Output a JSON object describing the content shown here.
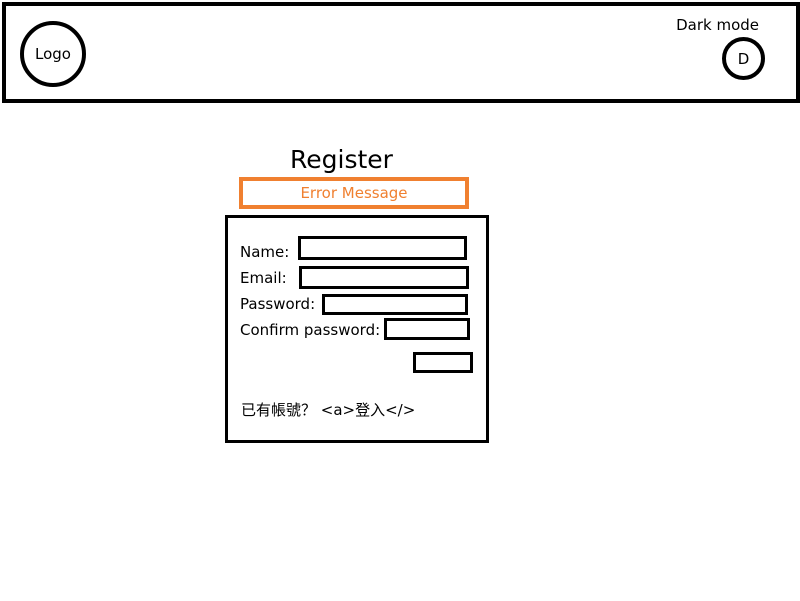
{
  "header": {
    "logo_label": "Logo",
    "dark_mode_label": "Dark mode",
    "dark_mode_toggle_label": "D"
  },
  "register": {
    "title": "Register",
    "error_message": "Error Message",
    "fields": {
      "name_label": "Name:",
      "email_label": "Email:",
      "password_label": "Password:",
      "confirm_password_label": "Confirm password:"
    },
    "footer": {
      "prompt": "已有帳號？ ",
      "link_text": "<a>登入</>"
    }
  },
  "colors": {
    "error": "#f08030",
    "border": "#000000"
  }
}
